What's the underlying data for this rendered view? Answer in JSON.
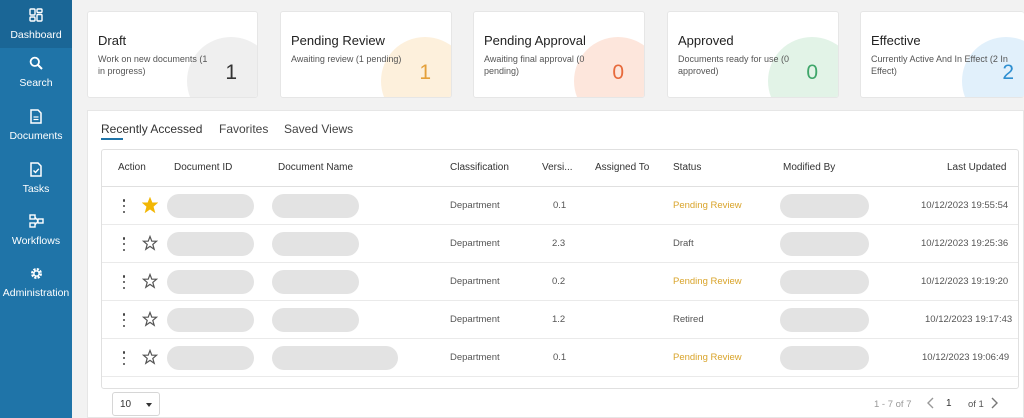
{
  "sidebar": {
    "items": [
      {
        "label": "Dashboard",
        "icon": "dashboard-icon"
      },
      {
        "label": "Search",
        "icon": "search-icon"
      },
      {
        "label": "Documents",
        "icon": "document-icon"
      },
      {
        "label": "Tasks",
        "icon": "task-icon"
      },
      {
        "label": "Workflows",
        "icon": "workflow-icon"
      },
      {
        "label": "Administration",
        "icon": "gear-icon"
      }
    ]
  },
  "cards": [
    {
      "title": "Draft",
      "desc": "Work on new documents (1 in progress)",
      "count": "1",
      "color": "#333333",
      "circle": "#efefef"
    },
    {
      "title": "Pending Review",
      "desc": "Awaiting review (1 pending)",
      "count": "1",
      "color": "#e4a03a",
      "circle": "#fdf0dc"
    },
    {
      "title": "Pending Approval",
      "desc": "Awaiting final approval (0 pending)",
      "count": "0",
      "color": "#e76a3c",
      "circle": "#fde6dc"
    },
    {
      "title": "Approved",
      "desc": "Documents ready for use (0 approved)",
      "count": "0",
      "color": "#3fa66a",
      "circle": "#e2f3e7"
    },
    {
      "title": "Effective",
      "desc": "Currently Active And In Effect (2 In Effect)",
      "count": "2",
      "color": "#2e8fd1",
      "circle": "#e1f0fb"
    }
  ],
  "tabs": [
    "Recently Accessed",
    "Favorites",
    "Saved Views"
  ],
  "table": {
    "headers": [
      "Action",
      "Document ID",
      "Document Name",
      "Classification",
      "Versi...",
      "Assigned To",
      "Status",
      "Modified By",
      "Last Updated"
    ],
    "rows": [
      {
        "favorite": true,
        "classification": "Department",
        "version": "0.1",
        "status": "Pending Review",
        "updated": "10/12/2023 19:55:54"
      },
      {
        "favorite": false,
        "classification": "Department",
        "version": "2.3",
        "status": "Draft",
        "updated": "10/12/2023 19:25:36"
      },
      {
        "favorite": false,
        "classification": "Department",
        "version": "0.2",
        "status": "Pending Review",
        "updated": "10/12/2023 19:19:20"
      },
      {
        "favorite": false,
        "classification": "Department",
        "version": "1.2",
        "status": "Retired",
        "updated": "10/12/2023 19:17:43"
      },
      {
        "favorite": false,
        "classification": "Department",
        "version": "0.1",
        "status": "Pending Review",
        "updated": "10/12/2023 19:06:49"
      }
    ]
  },
  "pagination": {
    "page_size": "10",
    "range": "1 - 7 of 7",
    "page": "1",
    "of": "of 1"
  },
  "colors": {
    "sidebar": "#1f74a8",
    "pending": "#d9a42b",
    "star_active": "#f2b705"
  }
}
